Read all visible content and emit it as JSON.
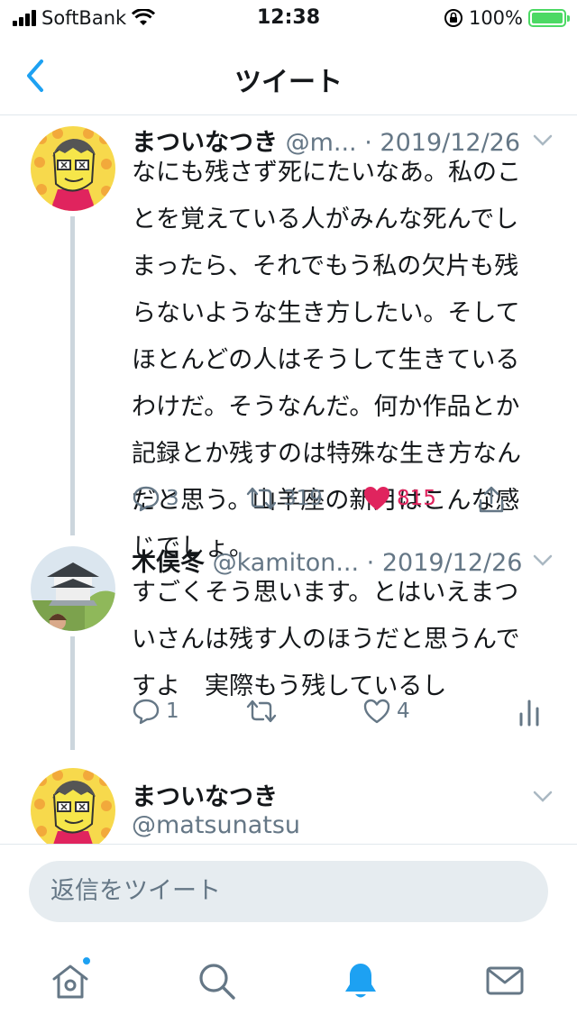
{
  "status_bar": {
    "carrier": "SoftBank",
    "time": "12:38",
    "battery": "100%"
  },
  "nav": {
    "title": "ツイート"
  },
  "tweets": [
    {
      "name": "まついなつき",
      "handle": "@m...",
      "date": "· 2019/12/26",
      "text": [
        "なにも残さず死にたいなあ。私のこ",
        "とを覚えている人がみんな死んでし",
        "まったら、それでもう私の欠片も残",
        "らないような生き方したい。そして",
        "ほとんどの人はそうして生きている",
        "わけだ。そうなんだ。何か作品とか",
        "記録とか残すのは特殊な生き方なん",
        "だと思う。山羊座の新月はこんな感",
        "じでしょ。"
      ],
      "replies": "3",
      "retweets": "319",
      "likes": "815"
    },
    {
      "name": "木俣冬",
      "handle": "@kamiton...",
      "date": "· 2019/12/26",
      "text": [
        "すごくそう思います。とはいえまつ",
        "いさんは残す人のほうだと思うんで",
        "すよ　実際もう残しているし"
      ],
      "replies": "1",
      "retweets": "",
      "likes": "4"
    },
    {
      "name": "まついなつき",
      "handle": "@matsunatsu"
    }
  ],
  "reply_bar": {
    "placeholder": "返信をツイート"
  },
  "colors": {
    "accent": "#1da1f2",
    "like": "#e0245e",
    "muted": "#657786",
    "thread_line": "#ccd6dd"
  }
}
